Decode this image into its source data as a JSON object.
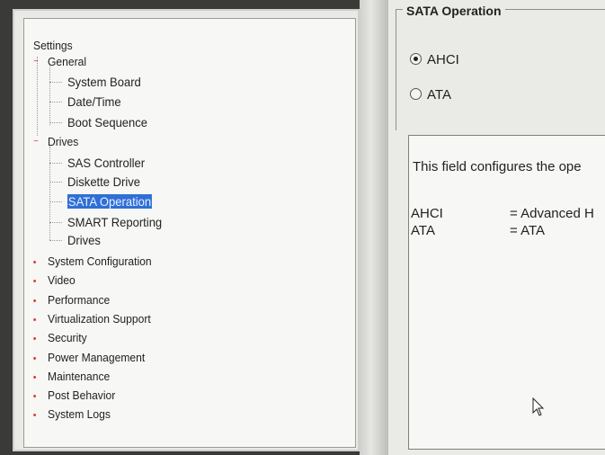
{
  "tree": {
    "root": "Settings",
    "general": {
      "label": "General",
      "children": [
        "System Board",
        "Date/Time",
        "Boot Sequence"
      ]
    },
    "drives": {
      "label": "Drives",
      "children": [
        "SAS Controller",
        "Diskette Drive",
        "SATA Operation",
        "SMART Reporting",
        "Drives"
      ],
      "selected": "SATA Operation"
    },
    "collapsed": [
      "System Configuration",
      "Video",
      "Performance",
      "Virtualization Support",
      "Security",
      "Power Management",
      "Maintenance",
      "Post Behavior",
      "System Logs"
    ]
  },
  "panel": {
    "group_title": "SATA Operation",
    "options": [
      {
        "label": "AHCI",
        "selected": true
      },
      {
        "label": "ATA",
        "selected": false
      }
    ],
    "help": {
      "intro": "This field configures the ope",
      "definitions": [
        {
          "key": "AHCI",
          "value": "= Advanced H"
        },
        {
          "key": "ATA",
          "value": "= ATA"
        }
      ]
    }
  },
  "colors": {
    "selection": "#2f6fd6",
    "expander": "#c23a3a"
  }
}
